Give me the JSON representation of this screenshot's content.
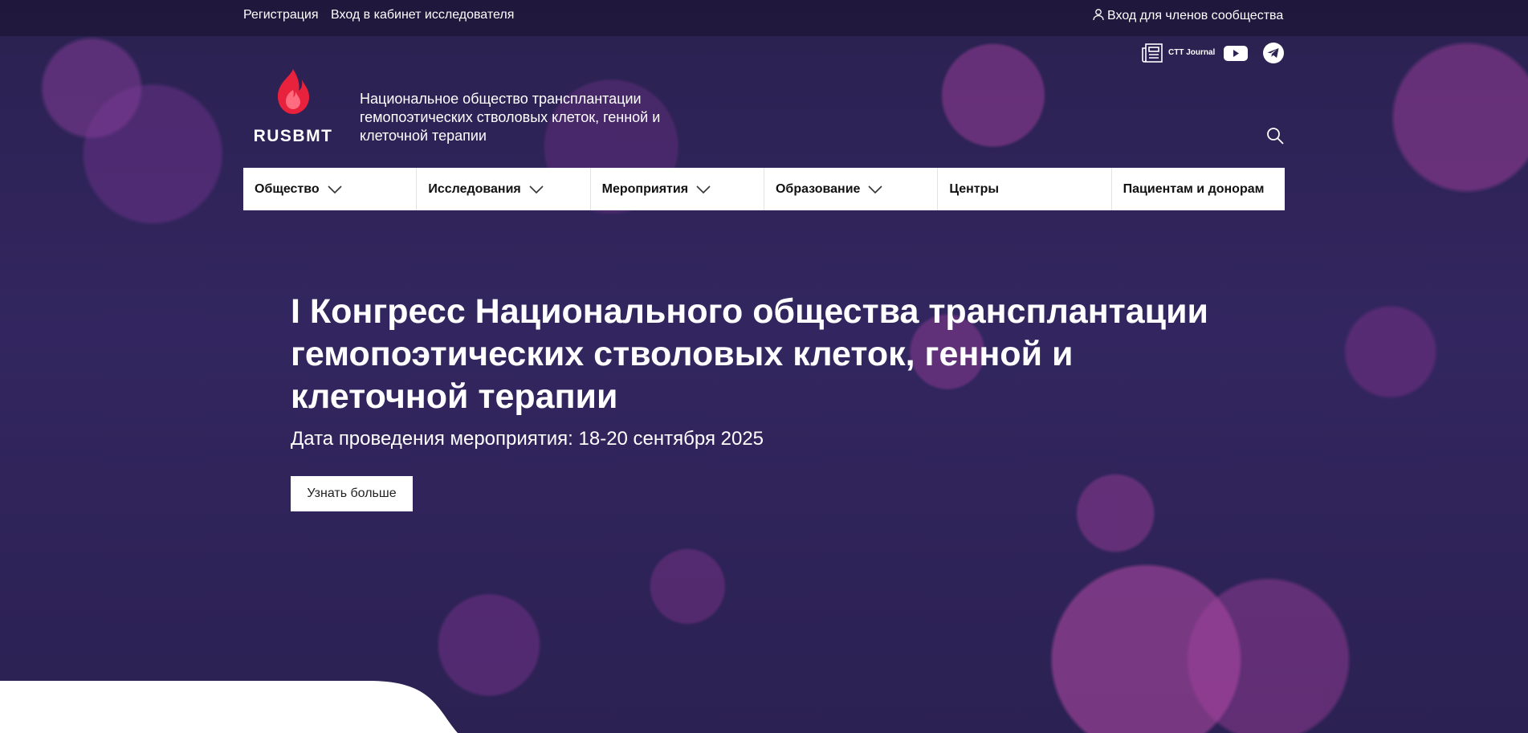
{
  "topbar": {
    "register_link": "Регистрация",
    "researcher_link": "Вход в кабинет исследователя",
    "member_login": "Вход для членов сообщества"
  },
  "social": {
    "journal_label": "CTT Journal",
    "youtube_icon": "youtube-icon",
    "telegram_icon": "telegram-icon"
  },
  "brand": {
    "logo_text": "RUSBMT",
    "org_name": "Национальное общество трансплантации гемопоэтических стволовых клеток, генной и клеточной терапии",
    "accent_color": "#e8213d"
  },
  "nav": {
    "items": [
      {
        "label": "Общество",
        "dropdown": true
      },
      {
        "label": "Исследования",
        "dropdown": true
      },
      {
        "label": "Мероприятия",
        "dropdown": true
      },
      {
        "label": "Образование",
        "dropdown": true
      },
      {
        "label": "Центры",
        "dropdown": false
      },
      {
        "label": "Пациентам и донорам",
        "dropdown": false
      }
    ]
  },
  "hero": {
    "title": "I Конгресс Национального общества трансплантации гемопоэтических стволовых клеток, генной и клеточной терапии",
    "date": "Дата проведения мероприятия: 18-20 сентября 2025",
    "button_label": "Узнать больше"
  }
}
